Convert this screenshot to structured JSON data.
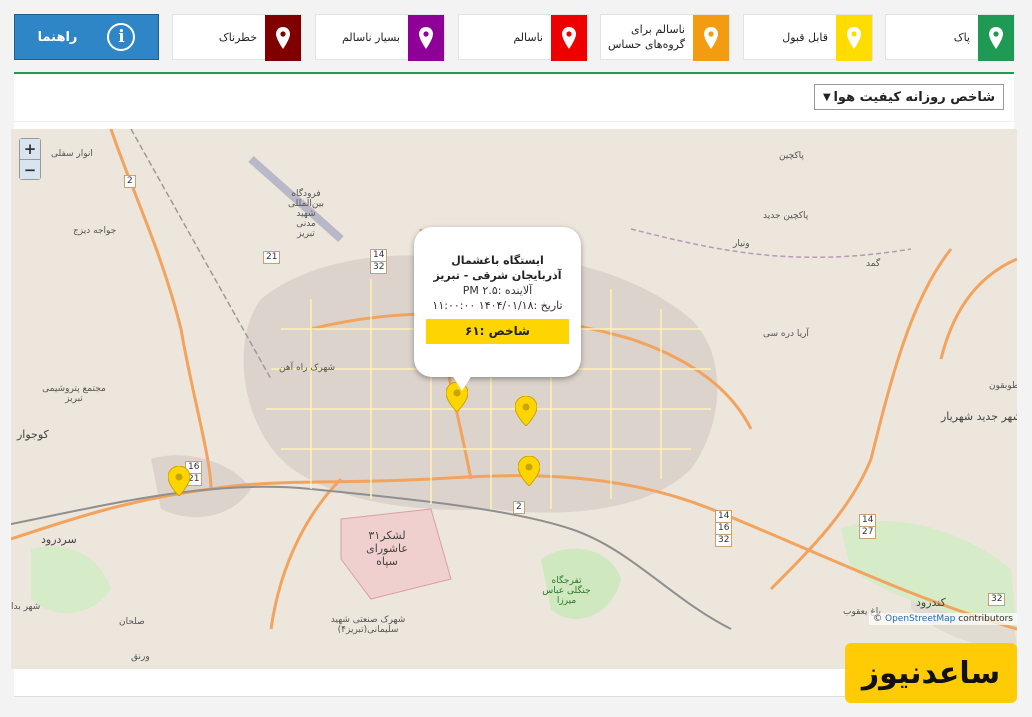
{
  "help_button": {
    "label": "راهنما",
    "icon": "info-icon"
  },
  "legend": [
    {
      "key": "hazardous",
      "label": "خطرناک",
      "color": "#800000"
    },
    {
      "key": "very_unhealthy",
      "label": "بسیار ناسالم",
      "color": "#8e0098"
    },
    {
      "key": "unhealthy",
      "label": "ناسالم",
      "color": "#ee0000"
    },
    {
      "key": "sensitive",
      "label": "ناسالم برای گروه‌های حساس",
      "color": "#f39c12"
    },
    {
      "key": "acceptable",
      "label": "قابل قبول",
      "color": "#ffdd00"
    },
    {
      "key": "clean",
      "label": "پاک",
      "color": "#1e9a55"
    }
  ],
  "index_select": {
    "value": "شاخص روزانه کیفیت هوا"
  },
  "map": {
    "zoom_in": "+",
    "zoom_out": "−",
    "attribution_prefix": "©",
    "attribution_link": "OpenStreetMap",
    "attribution_suffix": "contributors",
    "labels": {
      "anvar": "انوار سفلی",
      "airport": "فرودگاه بین‌المللی شهید مدنی تبریز",
      "javadieh": "جواجه دیزج",
      "pakchin": "پاکچین",
      "pakchin_new": "پاکچین جدید",
      "vonyar": "ونیار",
      "gamad": "گمد",
      "arya": "آریا دره سی",
      "tavagun": "طوبقون",
      "shahrak_rahahan": "شهرک راه آهن",
      "petrochem": "مجتمع پتروشیمی تبریز",
      "kojvar": "کوجوار",
      "shahryar": "شهر جدید شهریار",
      "sardrood": "سردرود",
      "lashkar": "لشکر۳۱ عاشورای سپاه",
      "forest_park": "تفرجگاه جنگلی عباس میرزا",
      "industrial": "شهرک صنعتی شهید سلیمانی(تبریز۴)",
      "kondrood": "کندرود",
      "bagh": "باغ یعقوب",
      "varnagh": "ورنق",
      "shahr_bad": "شهر بدا",
      "salan": "صلحان"
    },
    "road_shields": [
      "2",
      "21",
      "14",
      "32",
      "16",
      "21",
      "2",
      "14",
      "16",
      "32",
      "14",
      "27",
      "32"
    ]
  },
  "popup": {
    "station": "ایستگاه باغشمال",
    "location": "آذربایجان شرقی - تبریز",
    "pollutant": "آلاینده :PM ۲.۵",
    "date": "تاریخ :۱۴۰۴/۰۱/۱۸ ۱۱:۰۰:۰۰",
    "index_label": "شاخص :۶۱"
  },
  "status_colors": {
    "marker_yellow": "#ffd500",
    "accent_green": "#1e9a55"
  },
  "watermark": "ساعدنیوز"
}
